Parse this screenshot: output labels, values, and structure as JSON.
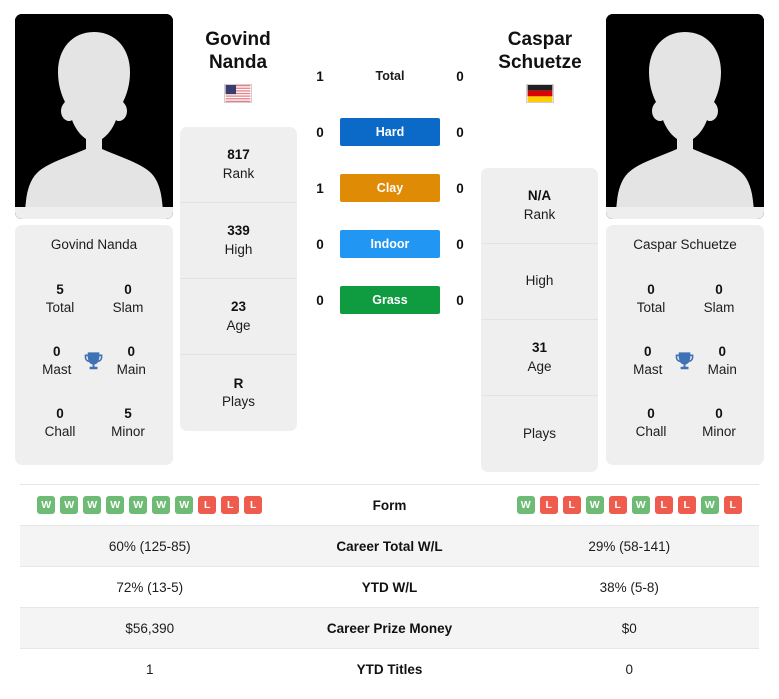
{
  "colors": {
    "hard": "#0b69c7",
    "clay": "#e08b05",
    "indoor": "#2196f3",
    "grass": "#0f9b3f",
    "win": "#6dbb74",
    "loss": "#ef5b4c",
    "trophy": "#3f72b5",
    "card_bg": "#efefef",
    "row_alt": "#f4f4f4"
  },
  "players": {
    "left": {
      "first_name": "Govind",
      "last_name": "Nanda",
      "full_name": "Govind Nanda",
      "country": "United States",
      "flag_icon": "flag-us",
      "avatar_icon": "player-silhouette-avatar",
      "titles": {
        "total_value": "5",
        "total_label": "Total",
        "slam_value": "0",
        "slam_label": "Slam",
        "mast_value": "0",
        "mast_label": "Mast",
        "main_value": "0",
        "main_label": "Main",
        "chall_value": "0",
        "chall_label": "Chall",
        "minor_value": "5",
        "minor_label": "Minor"
      },
      "info": [
        {
          "value": "817",
          "label": "Rank"
        },
        {
          "value": "339",
          "label": "High"
        },
        {
          "value": "23",
          "label": "Age"
        },
        {
          "value": "R",
          "label": "Plays"
        }
      ],
      "form": [
        "W",
        "W",
        "W",
        "W",
        "W",
        "W",
        "W",
        "L",
        "L",
        "L"
      ],
      "career_total_wl": "60% (125-85)",
      "ytd_wl": "72% (13-5)",
      "career_prize_money": "$56,390",
      "ytd_titles": "1"
    },
    "right": {
      "first_name": "Caspar",
      "last_name": "Schuetze",
      "full_name": "Caspar Schuetze",
      "country": "Germany",
      "flag_icon": "flag-de",
      "avatar_icon": "player-silhouette-avatar",
      "titles": {
        "total_value": "0",
        "total_label": "Total",
        "slam_value": "0",
        "slam_label": "Slam",
        "mast_value": "0",
        "mast_label": "Mast",
        "main_value": "0",
        "main_label": "Main",
        "chall_value": "0",
        "chall_label": "Chall",
        "minor_value": "0",
        "minor_label": "Minor"
      },
      "info": [
        {
          "value": "N/A",
          "label": "Rank"
        },
        {
          "value": "",
          "label": "High"
        },
        {
          "value": "31",
          "label": "Age"
        },
        {
          "value": "",
          "label": "Plays"
        }
      ],
      "form": [
        "W",
        "L",
        "L",
        "W",
        "L",
        "W",
        "L",
        "L",
        "W",
        "L"
      ],
      "career_total_wl": "29% (58-141)",
      "ytd_wl": "38% (5-8)",
      "career_prize_money": "$0",
      "ytd_titles": "0"
    }
  },
  "head_to_head": [
    {
      "label": "Total",
      "left": "1",
      "right": "0",
      "style": "plain"
    },
    {
      "label": "Hard",
      "left": "0",
      "right": "0",
      "style": "hard"
    },
    {
      "label": "Clay",
      "left": "1",
      "right": "0",
      "style": "clay"
    },
    {
      "label": "Indoor",
      "left": "0",
      "right": "0",
      "style": "indoor"
    },
    {
      "label": "Grass",
      "left": "0",
      "right": "0",
      "style": "grass"
    }
  ],
  "comparison_rows": [
    {
      "key": "form",
      "label": "Form"
    },
    {
      "key": "career_wl",
      "label": "Career Total W/L",
      "left": "60% (125-85)",
      "right": "29% (58-141)"
    },
    {
      "key": "ytd_wl",
      "label": "YTD W/L",
      "left": "72% (13-5)",
      "right": "38% (5-8)"
    },
    {
      "key": "prize",
      "label": "Career Prize Money",
      "left": "$56,390",
      "right": "$0"
    },
    {
      "key": "ytd_titles",
      "label": "YTD Titles",
      "left": "1",
      "right": "0"
    }
  ]
}
